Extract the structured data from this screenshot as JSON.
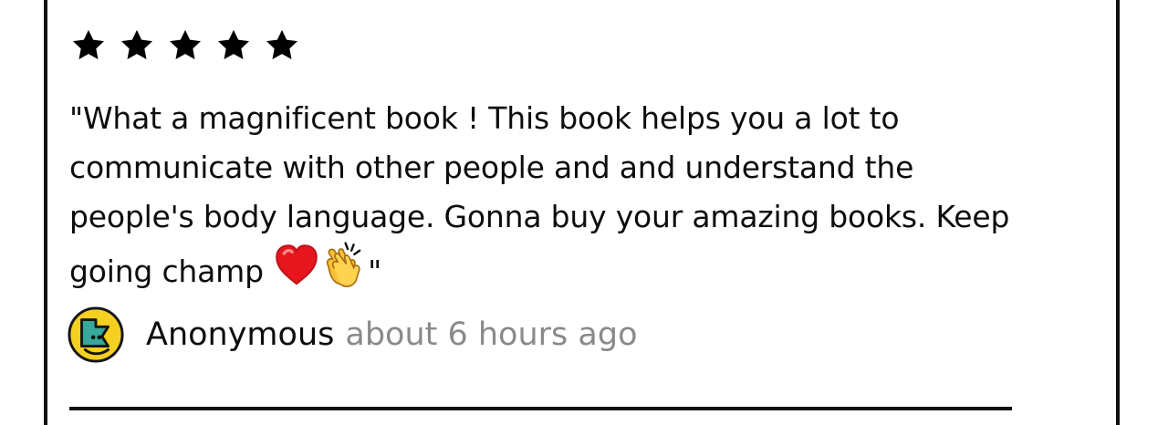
{
  "review": {
    "rating": 5,
    "rating_max": 5,
    "text": "\"What a magnificent book ! This book helps you a lot to communicate with other people and and understand the people's body language. Gonna buy your amazing books. Keep going champ ",
    "emojis": [
      "red-heart",
      "clapping-hands"
    ],
    "closing_quote": "\"",
    "author": "Anonymous",
    "timestamp": "about 6 hours ago"
  },
  "colors": {
    "text": "#0d0d0d",
    "muted": "#8a8a8a",
    "border": "#111111",
    "star": "#000000",
    "avatar_yellow": "#f5d020",
    "avatar_teal": "#36a89c"
  }
}
